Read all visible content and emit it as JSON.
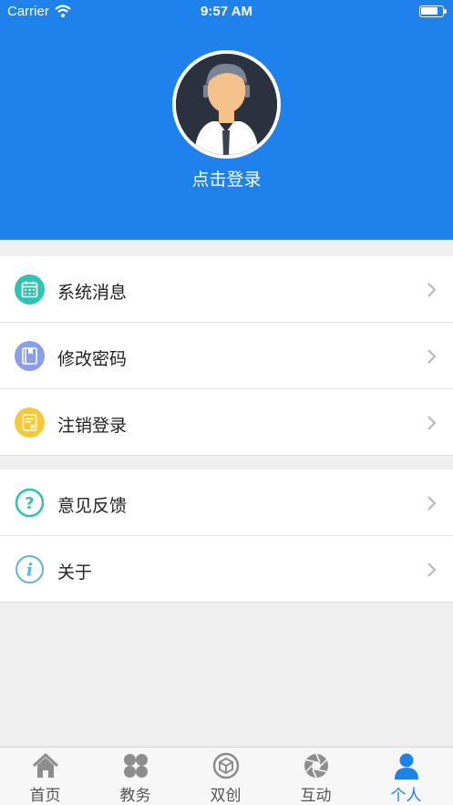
{
  "status_bar": {
    "carrier": "Carrier",
    "time": "9:57 AM"
  },
  "profile": {
    "login_label": "点击登录"
  },
  "menu_group_1": [
    {
      "label": "系统消息",
      "icon": "calendar-icon",
      "color": "#2ec3b4"
    },
    {
      "label": "修改密码",
      "icon": "book-icon",
      "color": "#8a9de8"
    },
    {
      "label": "注销登录",
      "icon": "document-icon",
      "color": "#f6c839"
    }
  ],
  "menu_group_2": [
    {
      "label": "意见反馈",
      "icon": "question-icon",
      "color": "#2ec3b4"
    },
    {
      "label": "关于",
      "icon": "info-icon",
      "color": "#5ab4ee"
    }
  ],
  "tabs": [
    {
      "label": "首页",
      "icon": "home-icon"
    },
    {
      "label": "教务",
      "icon": "grid-icon"
    },
    {
      "label": "双创",
      "icon": "cube-icon"
    },
    {
      "label": "互动",
      "icon": "aperture-icon"
    },
    {
      "label": "个人",
      "icon": "person-icon",
      "active": true
    }
  ],
  "colors": {
    "primary": "#1f82ec",
    "background": "#efefef"
  }
}
